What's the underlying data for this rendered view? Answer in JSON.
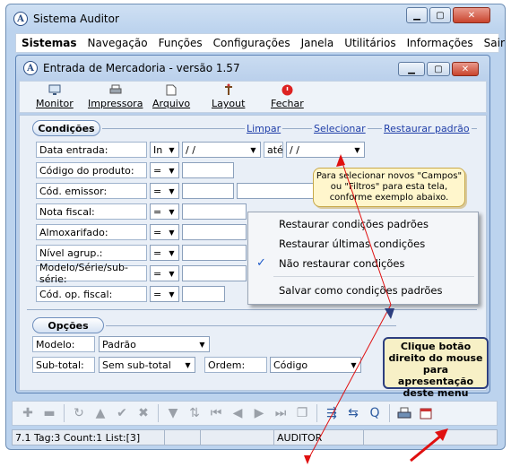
{
  "outer_window": {
    "title": "Sistema Auditor",
    "icon": "A"
  },
  "menubar": [
    "Sistemas",
    "Navegação",
    "Funções",
    "Configurações",
    "Janela",
    "Utilitários",
    "Informações",
    "Sair"
  ],
  "inner_window": {
    "title": "Entrada de Mercadoria - versão 1.57",
    "icon": "A"
  },
  "toolbar": [
    {
      "label": "Monitor",
      "icon": "monitor-icon"
    },
    {
      "label": "Impressora",
      "icon": "printer-icon"
    },
    {
      "label": "Arquivo",
      "icon": "file-icon"
    },
    {
      "label": "Layout",
      "icon": "layout-icon"
    },
    {
      "label": "Fechar",
      "icon": "power-icon"
    }
  ],
  "conditions": {
    "title": "Condições",
    "links": {
      "clear": "Limpar",
      "select": "Selecionar",
      "restore": "Restaurar padrão"
    },
    "rows": [
      {
        "label": "Data entrada:",
        "op": "In",
        "value": " / /",
        "between": "até",
        "value2": " / /"
      },
      {
        "label": "Código do produto:",
        "op": "=",
        "value": ""
      },
      {
        "label": "Cód. emissor:",
        "op": "=",
        "value": ""
      },
      {
        "label": "Nota fiscal:",
        "op": "=",
        "value": ""
      },
      {
        "label": "Almoxarifado:",
        "op": "=",
        "value": ""
      },
      {
        "label": "Nível agrup.:",
        "op": "=",
        "value": ""
      },
      {
        "label": "Modelo/Série/sub-série:",
        "op": "=",
        "value": ""
      },
      {
        "label": "Cód. op. fiscal:",
        "op": "=",
        "value": ""
      }
    ]
  },
  "options": {
    "title": "Opções",
    "model_label": "Modelo:",
    "model_value": "Padrão",
    "subtotal_label": "Sub-total:",
    "subtotal_value": "Sem sub-total",
    "order_label": "Ordem:",
    "order_value": "Código"
  },
  "balloon": {
    "text": "Para selecionar novos \"Campos\" ou \"Filtros\" para esta tela, conforme exemplo abaixo."
  },
  "context_menu": {
    "items": [
      "Restaurar condições padrões",
      "Restaurar últimas condições",
      "Não restaurar condições",
      "Salvar como condições padrões"
    ],
    "checked_index": 2
  },
  "tip": {
    "text": "Clique botão direito do mouse para apresentação deste menu"
  },
  "status": {
    "left": "7.1 Tag:3 Count:1 List:[3]",
    "user": "AUDITOR"
  },
  "colors": {
    "link": "#1f3ea8",
    "tip_border": "#2c3e7f",
    "arrow": "#e01010",
    "check": "#1c59c8"
  }
}
